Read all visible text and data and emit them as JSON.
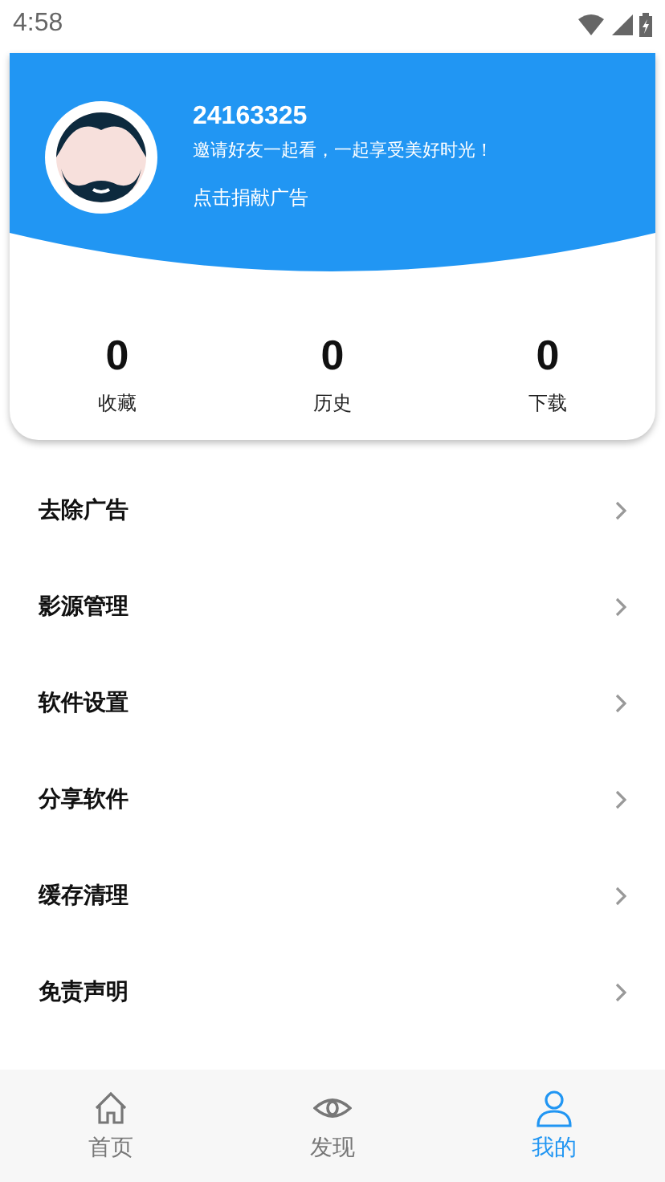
{
  "status_bar": {
    "time": "4:58"
  },
  "profile": {
    "user_id": "24163325",
    "slogan": "邀请好友一起看，一起享受美好时光！",
    "donate_link": "点击捐献广告"
  },
  "stats": [
    {
      "count": "0",
      "label": "收藏"
    },
    {
      "count": "0",
      "label": "历史"
    },
    {
      "count": "0",
      "label": "下载"
    }
  ],
  "menu": [
    {
      "label": "去除广告"
    },
    {
      "label": "影源管理"
    },
    {
      "label": "软件设置"
    },
    {
      "label": "分享软件"
    },
    {
      "label": "缓存清理"
    },
    {
      "label": "免责声明"
    }
  ],
  "tab_bar": [
    {
      "label": "首页",
      "kind": "home",
      "selected": false
    },
    {
      "label": "发现",
      "kind": "discover",
      "selected": false
    },
    {
      "label": "我的",
      "kind": "profile",
      "selected": true
    }
  ]
}
